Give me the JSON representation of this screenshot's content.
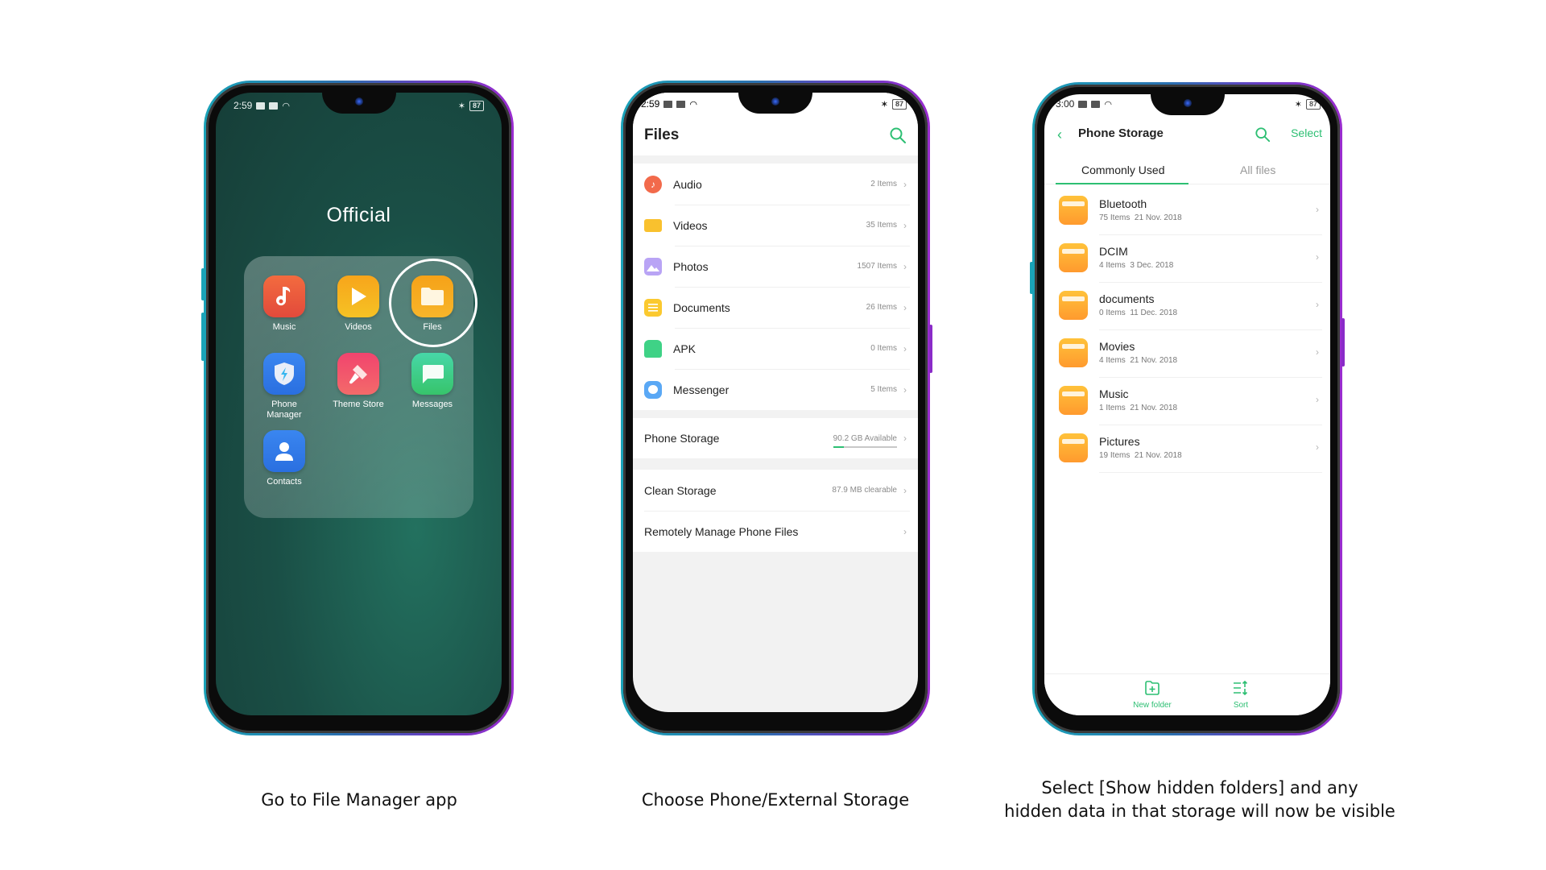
{
  "colors": {
    "accent_green": "#2dbf73",
    "home_bg": "#1a4f46",
    "files_bg": "#f2f2f2"
  },
  "steps": [
    {
      "caption": "Go to File Manager app",
      "status": {
        "time": "2:59",
        "battery": "87"
      },
      "folder_title": "Official",
      "apps": [
        {
          "label": "Music",
          "icon": "music-note-icon",
          "color": "#e8503a"
        },
        {
          "label": "Videos",
          "icon": "play-icon",
          "color": "#f5b120"
        },
        {
          "label": "Files",
          "icon": "folder-icon",
          "color": "#f6a91a",
          "highlighted": true
        },
        {
          "label": "Phone\nManager",
          "icon": "shield-bolt-icon",
          "color": "#2e7be8"
        },
        {
          "label": "Theme Store",
          "icon": "paintbrush-icon",
          "color": "#f2506f"
        },
        {
          "label": "Messages",
          "icon": "chat-bubble-icon",
          "color": "#3ec97a"
        },
        {
          "label": "Contacts",
          "icon": "person-icon",
          "color": "#2e7be8"
        }
      ]
    },
    {
      "caption": "Choose Phone/External Storage",
      "status": {
        "time": "2:59",
        "battery": "87"
      },
      "title": "Files",
      "categories": [
        {
          "label": "Audio",
          "meta": "2 Items",
          "icon": "audio-icon",
          "color": "#f26a4b"
        },
        {
          "label": "Videos",
          "meta": "35 Items",
          "icon": "video-camera-icon",
          "color": "#f9c12e"
        },
        {
          "label": "Photos",
          "meta": "1507 Items",
          "icon": "photo-icon",
          "color": "#a98cf2"
        },
        {
          "label": "Documents",
          "meta": "26 Items",
          "icon": "document-icon",
          "color": "#fbc92f"
        },
        {
          "label": "APK",
          "meta": "0 Items",
          "icon": "android-icon",
          "color": "#3fd286"
        },
        {
          "label": "Messenger",
          "meta": "5 Items",
          "icon": "messenger-icon",
          "color": "#5aa8f5"
        }
      ],
      "phone_storage": {
        "label": "Phone Storage",
        "meta": "90.2 GB Available",
        "used_fraction": 0.17
      },
      "clean_storage": {
        "label": "Clean Storage",
        "meta": "87.9 MB clearable"
      },
      "remote_manage": {
        "label": "Remotely Manage Phone Files"
      }
    },
    {
      "caption_line1": "Select [Show hidden folders] and any",
      "caption_line2": "hidden data in that storage will now be visible",
      "status": {
        "time": "3:00",
        "battery": "87"
      },
      "title": "Phone Storage",
      "select_label": "Select",
      "tabs": [
        {
          "label": "Commonly Used",
          "active": true
        },
        {
          "label": "All files",
          "active": false
        }
      ],
      "folders": [
        {
          "name": "Bluetooth",
          "items": "75 Items",
          "date": "21 Nov. 2018"
        },
        {
          "name": "DCIM",
          "items": "4 Items",
          "date": "3 Dec. 2018"
        },
        {
          "name": "documents",
          "items": "0 Items",
          "date": "11 Dec. 2018"
        },
        {
          "name": "Movies",
          "items": "4 Items",
          "date": "21 Nov. 2018"
        },
        {
          "name": "Music",
          "items": "1 Items",
          "date": "21 Nov. 2018"
        },
        {
          "name": "Pictures",
          "items": "19 Items",
          "date": "21 Nov. 2018"
        }
      ],
      "bottom_actions": [
        {
          "label": "New folder",
          "icon": "new-folder-icon"
        },
        {
          "label": "Sort",
          "icon": "sort-icon"
        }
      ]
    }
  ]
}
